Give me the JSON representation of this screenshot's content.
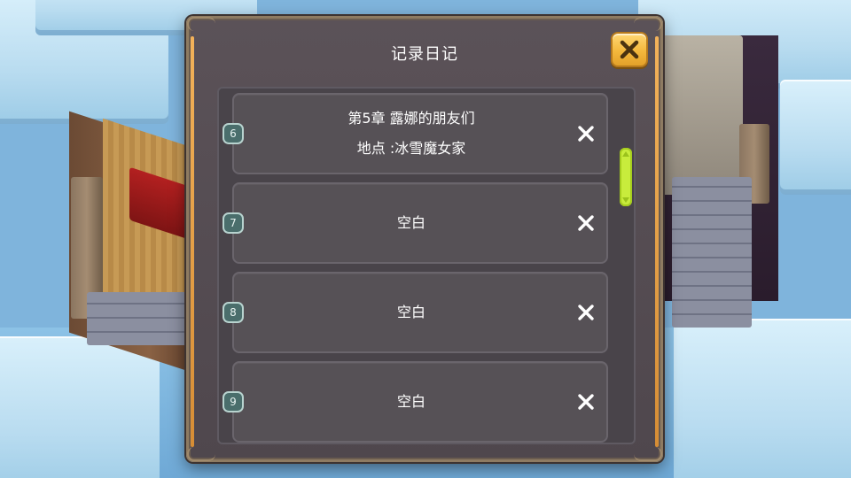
{
  "dialog": {
    "title": "记录日记",
    "close_icon": "close-x-icon",
    "accent_color": "#f4b83c"
  },
  "slots": [
    {
      "number": "6",
      "lines": [
        "第5章 露娜的朋友们",
        "地点 :冰雪魔女家"
      ],
      "delete_icon": "delete-x-icon"
    },
    {
      "number": "7",
      "lines": [
        "空白"
      ],
      "delete_icon": "delete-x-icon"
    },
    {
      "number": "8",
      "lines": [
        "空白"
      ],
      "delete_icon": "delete-x-icon"
    },
    {
      "number": "9",
      "lines": [
        "空白"
      ],
      "delete_icon": "delete-x-icon"
    }
  ],
  "scrollbar": {
    "color": "#c8ec3c"
  }
}
